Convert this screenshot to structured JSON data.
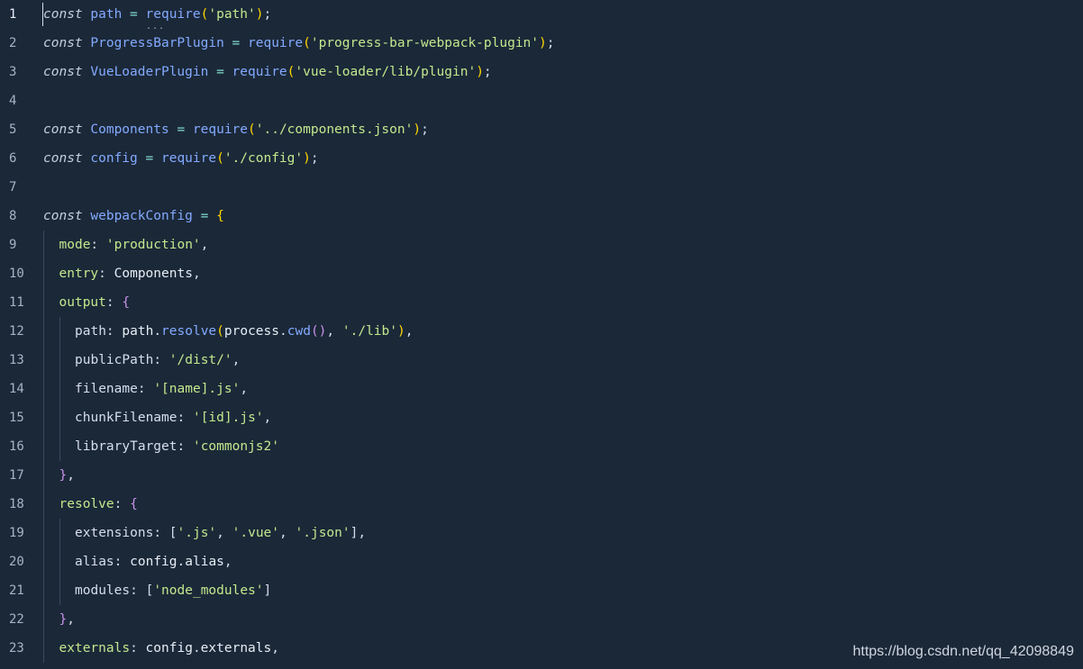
{
  "editor": {
    "lines": [
      {
        "n": "1",
        "active": true,
        "indent": 0,
        "tokens": [
          [
            "kw",
            "const"
          ],
          [
            "pn",
            " "
          ],
          [
            "var",
            "path"
          ],
          [
            "pn",
            " "
          ],
          [
            "op",
            "="
          ],
          [
            "pn",
            " "
          ],
          [
            "fn",
            "require"
          ],
          [
            "pr",
            "("
          ],
          [
            "str",
            "'path'"
          ],
          [
            "pr",
            ")"
          ],
          [
            "pn",
            ";"
          ]
        ]
      },
      {
        "n": "2",
        "indent": 0,
        "tokens": [
          [
            "kw",
            "const"
          ],
          [
            "pn",
            " "
          ],
          [
            "var",
            "ProgressBarPlugin"
          ],
          [
            "pn",
            " "
          ],
          [
            "op",
            "="
          ],
          [
            "pn",
            " "
          ],
          [
            "fn",
            "require"
          ],
          [
            "pr",
            "("
          ],
          [
            "str",
            "'progress-bar-webpack-plugin'"
          ],
          [
            "pr",
            ")"
          ],
          [
            "pn",
            ";"
          ]
        ]
      },
      {
        "n": "3",
        "indent": 0,
        "tokens": [
          [
            "kw",
            "const"
          ],
          [
            "pn",
            " "
          ],
          [
            "var",
            "VueLoaderPlugin"
          ],
          [
            "pn",
            " "
          ],
          [
            "op",
            "="
          ],
          [
            "pn",
            " "
          ],
          [
            "fn",
            "require"
          ],
          [
            "pr",
            "("
          ],
          [
            "str",
            "'vue-loader/lib/plugin'"
          ],
          [
            "pr",
            ")"
          ],
          [
            "pn",
            ";"
          ]
        ]
      },
      {
        "n": "4",
        "indent": 0,
        "tokens": []
      },
      {
        "n": "5",
        "indent": 0,
        "tokens": [
          [
            "kw",
            "const"
          ],
          [
            "pn",
            " "
          ],
          [
            "var",
            "Components"
          ],
          [
            "pn",
            " "
          ],
          [
            "op",
            "="
          ],
          [
            "pn",
            " "
          ],
          [
            "fn",
            "require"
          ],
          [
            "pr",
            "("
          ],
          [
            "str",
            "'../components.json'"
          ],
          [
            "pr",
            ")"
          ],
          [
            "pn",
            ";"
          ]
        ]
      },
      {
        "n": "6",
        "indent": 0,
        "tokens": [
          [
            "kw",
            "const"
          ],
          [
            "pn",
            " "
          ],
          [
            "var",
            "config"
          ],
          [
            "pn",
            " "
          ],
          [
            "op",
            "="
          ],
          [
            "pn",
            " "
          ],
          [
            "fn",
            "require"
          ],
          [
            "pr",
            "("
          ],
          [
            "str",
            "'./config'"
          ],
          [
            "pr",
            ")"
          ],
          [
            "pn",
            ";"
          ]
        ]
      },
      {
        "n": "7",
        "indent": 0,
        "tokens": []
      },
      {
        "n": "8",
        "indent": 0,
        "tokens": [
          [
            "kw",
            "const"
          ],
          [
            "pn",
            " "
          ],
          [
            "var",
            "webpackConfig"
          ],
          [
            "pn",
            " "
          ],
          [
            "op",
            "="
          ],
          [
            "pn",
            " "
          ],
          [
            "pr",
            "{"
          ]
        ]
      },
      {
        "n": "9",
        "indent": 1,
        "tokens": [
          [
            "prop",
            "mode"
          ],
          [
            "pn",
            ": "
          ],
          [
            "str",
            "'production'"
          ],
          [
            "pn",
            ","
          ]
        ]
      },
      {
        "n": "10",
        "indent": 1,
        "tokens": [
          [
            "prop",
            "entry"
          ],
          [
            "pn",
            ": "
          ],
          [
            "plain",
            "Components"
          ],
          [
            "pn",
            ","
          ]
        ]
      },
      {
        "n": "11",
        "indent": 1,
        "tokens": [
          [
            "prop",
            "output"
          ],
          [
            "pn",
            ": "
          ],
          [
            "pr2",
            "{"
          ]
        ]
      },
      {
        "n": "12",
        "indent": 2,
        "tokens": [
          [
            "key",
            "path"
          ],
          [
            "pn",
            ": "
          ],
          [
            "plain",
            "path"
          ],
          [
            "pn",
            "."
          ],
          [
            "fn",
            "resolve"
          ],
          [
            "pr",
            "("
          ],
          [
            "plain",
            "process"
          ],
          [
            "pn",
            "."
          ],
          [
            "fn",
            "cwd"
          ],
          [
            "pr2",
            "()"
          ],
          [
            "pn",
            ", "
          ],
          [
            "str",
            "'./lib'"
          ],
          [
            "pr",
            ")"
          ],
          [
            "pn",
            ","
          ]
        ]
      },
      {
        "n": "13",
        "indent": 2,
        "tokens": [
          [
            "key",
            "publicPath"
          ],
          [
            "pn",
            ": "
          ],
          [
            "str",
            "'/dist/'"
          ],
          [
            "pn",
            ","
          ]
        ]
      },
      {
        "n": "14",
        "indent": 2,
        "tokens": [
          [
            "key",
            "filename"
          ],
          [
            "pn",
            ": "
          ],
          [
            "str",
            "'[name].js'"
          ],
          [
            "pn",
            ","
          ]
        ]
      },
      {
        "n": "15",
        "indent": 2,
        "tokens": [
          [
            "key",
            "chunkFilename"
          ],
          [
            "pn",
            ": "
          ],
          [
            "str",
            "'[id].js'"
          ],
          [
            "pn",
            ","
          ]
        ]
      },
      {
        "n": "16",
        "indent": 2,
        "tokens": [
          [
            "key",
            "libraryTarget"
          ],
          [
            "pn",
            ": "
          ],
          [
            "str",
            "'commonjs2'"
          ]
        ]
      },
      {
        "n": "17",
        "indent": 1,
        "tokens": [
          [
            "pr2",
            "}"
          ],
          [
            "pn",
            ","
          ]
        ]
      },
      {
        "n": "18",
        "indent": 1,
        "tokens": [
          [
            "prop",
            "resolve"
          ],
          [
            "pn",
            ": "
          ],
          [
            "pr2",
            "{"
          ]
        ]
      },
      {
        "n": "19",
        "indent": 2,
        "tokens": [
          [
            "key",
            "extensions"
          ],
          [
            "pn",
            ": "
          ],
          [
            "pn",
            "["
          ],
          [
            "str",
            "'.js'"
          ],
          [
            "pn",
            ", "
          ],
          [
            "str",
            "'.vue'"
          ],
          [
            "pn",
            ", "
          ],
          [
            "str",
            "'.json'"
          ],
          [
            "pn",
            "],"
          ]
        ]
      },
      {
        "n": "20",
        "indent": 2,
        "tokens": [
          [
            "key",
            "alias"
          ],
          [
            "pn",
            ": "
          ],
          [
            "plain",
            "config"
          ],
          [
            "pn",
            "."
          ],
          [
            "plain",
            "alias"
          ],
          [
            "pn",
            ","
          ]
        ]
      },
      {
        "n": "21",
        "indent": 2,
        "tokens": [
          [
            "key",
            "modules"
          ],
          [
            "pn",
            ": "
          ],
          [
            "pn",
            "["
          ],
          [
            "str",
            "'node_modules'"
          ],
          [
            "pn",
            "]"
          ]
        ]
      },
      {
        "n": "22",
        "indent": 1,
        "tokens": [
          [
            "pr2",
            "}"
          ],
          [
            "pn",
            ","
          ]
        ]
      },
      {
        "n": "23",
        "indent": 1,
        "tokens": [
          [
            "prop",
            "externals"
          ],
          [
            "pn",
            ": "
          ],
          [
            "plain",
            "config"
          ],
          [
            "pn",
            "."
          ],
          [
            "plain",
            "externals"
          ],
          [
            "pn",
            ","
          ]
        ]
      }
    ],
    "hover_dots": "..."
  },
  "watermark": "https://blog.csdn.net/qq_42098849"
}
